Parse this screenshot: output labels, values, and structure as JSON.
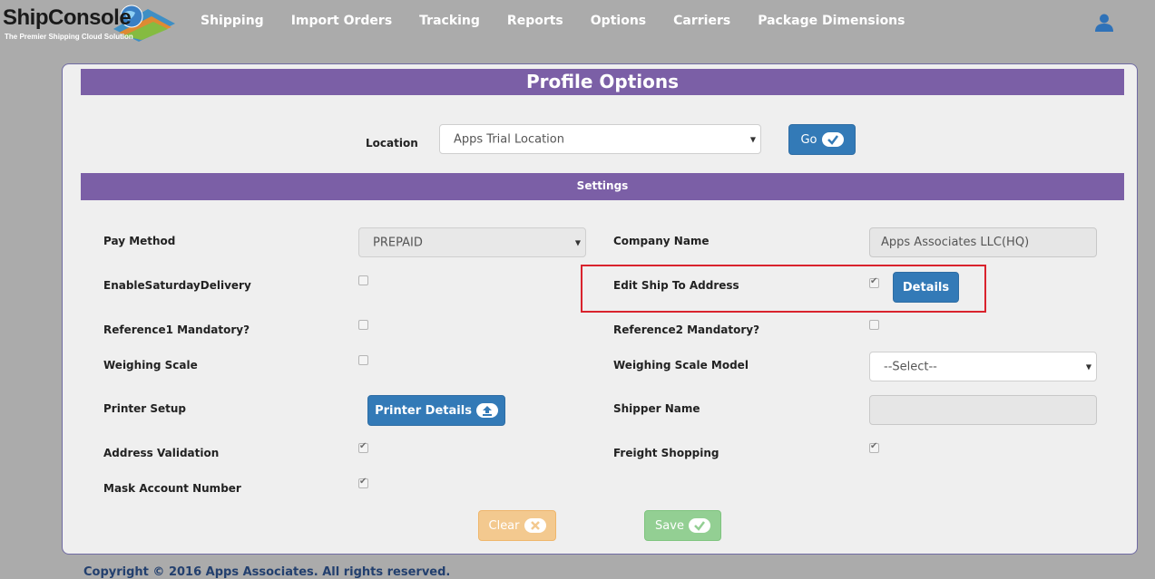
{
  "brand": {
    "name": "ShipConsole",
    "tagline": "The Premier Shipping Cloud Solution"
  },
  "nav": {
    "items": [
      "Shipping",
      "Import Orders",
      "Tracking",
      "Reports",
      "Options",
      "Carriers",
      "Package Dimensions"
    ]
  },
  "page": {
    "title": "Profile Options",
    "location_label": "Location",
    "location_value": "Apps Trial Location",
    "go_label": "Go",
    "settings_title": "Settings"
  },
  "settings": {
    "pay_method_label": "Pay Method",
    "pay_method_value": "PREPAID",
    "company_name_label": "Company Name",
    "company_name_value": "Apps Associates LLC(HQ)",
    "saturday_label": "EnableSaturdayDelivery",
    "saturday_checked": false,
    "edit_ship_label": "Edit Ship To Address",
    "edit_ship_checked": true,
    "details_label": "Details",
    "ref1_label": "Reference1 Mandatory?",
    "ref1_checked": false,
    "ref2_label": "Reference2 Mandatory?",
    "ref2_checked": false,
    "weighing_label": "Weighing Scale",
    "weighing_checked": false,
    "weighing_model_label": "Weighing Scale Model",
    "weighing_model_value": "--Select--",
    "printer_label": "Printer Setup",
    "printer_button": "Printer Details",
    "shipper_name_label": "Shipper Name",
    "shipper_name_value": "",
    "address_validation_label": "Address Validation",
    "address_validation_checked": true,
    "freight_label": "Freight Shopping",
    "freight_checked": true,
    "mask_label": "Mask Account Number",
    "mask_checked": true
  },
  "actions": {
    "clear_label": "Clear",
    "save_label": "Save"
  },
  "footer": {
    "text": "Copyright © 2016 Apps Associates. All rights reserved."
  },
  "colors": {
    "header_bg": "#ababab",
    "purple_bar": "#7b5fa6",
    "primary_button": "#337ab7",
    "highlight_border": "#d9232d",
    "clear_button": "#f3c98f",
    "save_button": "#93cf93"
  },
  "icons": {
    "user": "user-icon",
    "go": "check-circle-icon",
    "printer": "upload-icon",
    "clear": "close-circle-icon",
    "save": "check-circle-icon"
  }
}
